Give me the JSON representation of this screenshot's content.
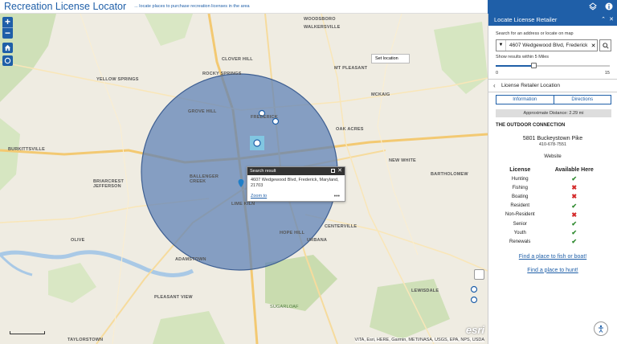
{
  "header": {
    "title": "Recreation License Locator",
    "subtitle": "... locate places to purchase recreation licenses in the area"
  },
  "map": {
    "set_location_label": "Set location",
    "popup": {
      "title": "Search result",
      "address_line1": "4607 Wedgewood Blvd, Frederick, Maryland,",
      "address_line2": "21703",
      "zoom_link": "Zoom to",
      "more": "•••"
    },
    "attribution": "VITA, Esri, HERE, Garmin, METI/NASA, USGS, EPA, NPS, USDA",
    "logo": "esri",
    "place_labels": [
      "WOODSBORO",
      "WALKERSVILLE",
      "CLOVER HILL",
      "ROCKY SPRINGS",
      "MT PLEASANT",
      "YELLOW SPRINGS",
      "FREDERICK",
      "GROVE HILL",
      "OAK ACRES",
      "BURKITTSVILLE",
      "BRIARCREST JEFFERSON",
      "BALLENGER CREEK",
      "LIME KILN",
      "NEW WHITE",
      "BARTHOLOMEW",
      "CENTERVILLE",
      "OLIVE",
      "HOPE HILL",
      "URBANA",
      "ADAMSTOWN",
      "PLEASANT VIEW",
      "LEWISDALE",
      "SUGARLOAF",
      "TAYLORSTOWN",
      "MCKAIG"
    ]
  },
  "panel": {
    "title": "Locate License Retailer",
    "search_label": "Search for an address or locate on map",
    "search_value": "4607 Wedgewood Blvd, Frederick",
    "radius_label": "Show results within 5 Miles",
    "radius": {
      "min": "0",
      "max": "15",
      "value": 5
    },
    "location_header": "License Retailer Location",
    "tabs": [
      "Information",
      "Directions"
    ],
    "distance": "Approximate Distance: 2.29 mi",
    "retailer_name": "THE OUTDOOR CONNECTION",
    "address": "5801 Buckeystown Pike",
    "phone": "410-678-7551",
    "website": "Website",
    "table_headers": [
      "License",
      "Available Here"
    ],
    "licenses": [
      {
        "name": "Hunting",
        "available": true
      },
      {
        "name": "Fishing",
        "available": false
      },
      {
        "name": "Boating",
        "available": false
      },
      {
        "name": "Resident",
        "available": true
      },
      {
        "name": "Non-Resident",
        "available": false
      },
      {
        "name": "Senior",
        "available": true
      },
      {
        "name": "Youth",
        "available": true
      },
      {
        "name": "Renewals",
        "available": true
      }
    ],
    "link_fish": "Find a place to fish or boat!",
    "link_hunt": "Find a place to hunt!"
  },
  "colors": {
    "primary": "#1f5fa8",
    "buffer": "#5b7fb5",
    "available": "#2f8a2f",
    "unavailable": "#d42a2a"
  }
}
